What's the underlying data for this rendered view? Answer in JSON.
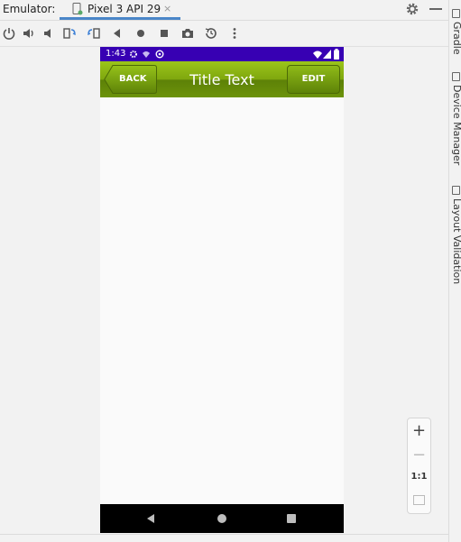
{
  "emulator_label": "Emulator:",
  "tab": {
    "title": "Pixel 3 API 29",
    "close_glyph": "×"
  },
  "toolbar": {
    "icons": [
      "power-icon",
      "volume-up-icon",
      "volume-down-icon",
      "rotate-left-icon",
      "rotate-right-icon",
      "back-icon",
      "home-icon",
      "overview-icon",
      "camera-icon",
      "snapshot-icon",
      "more-icon"
    ]
  },
  "side_tabs": [
    "Gradle",
    "Device Manager",
    "Layout Validation"
  ],
  "device": {
    "status_time": "1:43",
    "app_title": "Title Text",
    "back_label": "BACK",
    "edit_label": "EDIT",
    "status_bar_color": "#3700b3",
    "appbar_color": "#7fa70e"
  },
  "zoom": {
    "zoom_in": "+",
    "zoom_out": "−",
    "actual_size": "1:1"
  }
}
